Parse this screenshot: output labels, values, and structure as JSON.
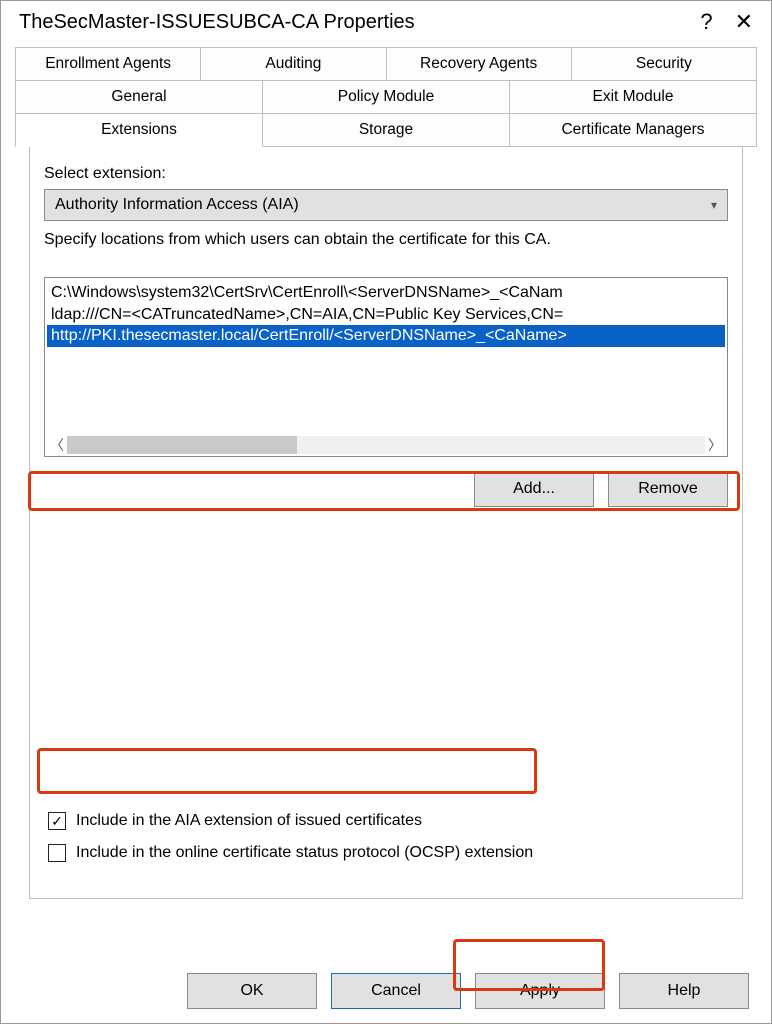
{
  "window": {
    "title": "TheSecMaster-ISSUESUBCA-CA Properties",
    "help_symbol": "?",
    "close_symbol": "✕"
  },
  "tabs": {
    "row1": [
      "Enrollment Agents",
      "Auditing",
      "Recovery Agents",
      "Security"
    ],
    "row2": [
      "General",
      "Policy Module",
      "Exit Module"
    ],
    "row3": [
      "Extensions",
      "Storage",
      "Certificate Managers"
    ],
    "active": "Extensions"
  },
  "ext": {
    "select_label": "Select extension:",
    "dropdown_value": "Authority Information Access (AIA)",
    "desc": "Specify locations from which users can obtain the certificate for this CA.",
    "items": [
      "C:\\Windows\\system32\\CertSrv\\CertEnroll\\<ServerDNSName>_<CaNam",
      "ldap:///CN=<CATruncatedName>,CN=AIA,CN=Public Key Services,CN=",
      "http://PKI.thesecmaster.local/CertEnroll/<ServerDNSName>_<CaName>"
    ],
    "selected_index": 2,
    "add_label": "Add...",
    "remove_label": "Remove",
    "check_aia_label": "Include in the AIA extension of issued certificates",
    "check_aia_checked": true,
    "check_ocsp_label": "Include in the online certificate status protocol (OCSP) extension",
    "check_ocsp_checked": false
  },
  "footer": {
    "ok": "OK",
    "cancel": "Cancel",
    "apply": "Apply",
    "help": "Help"
  }
}
